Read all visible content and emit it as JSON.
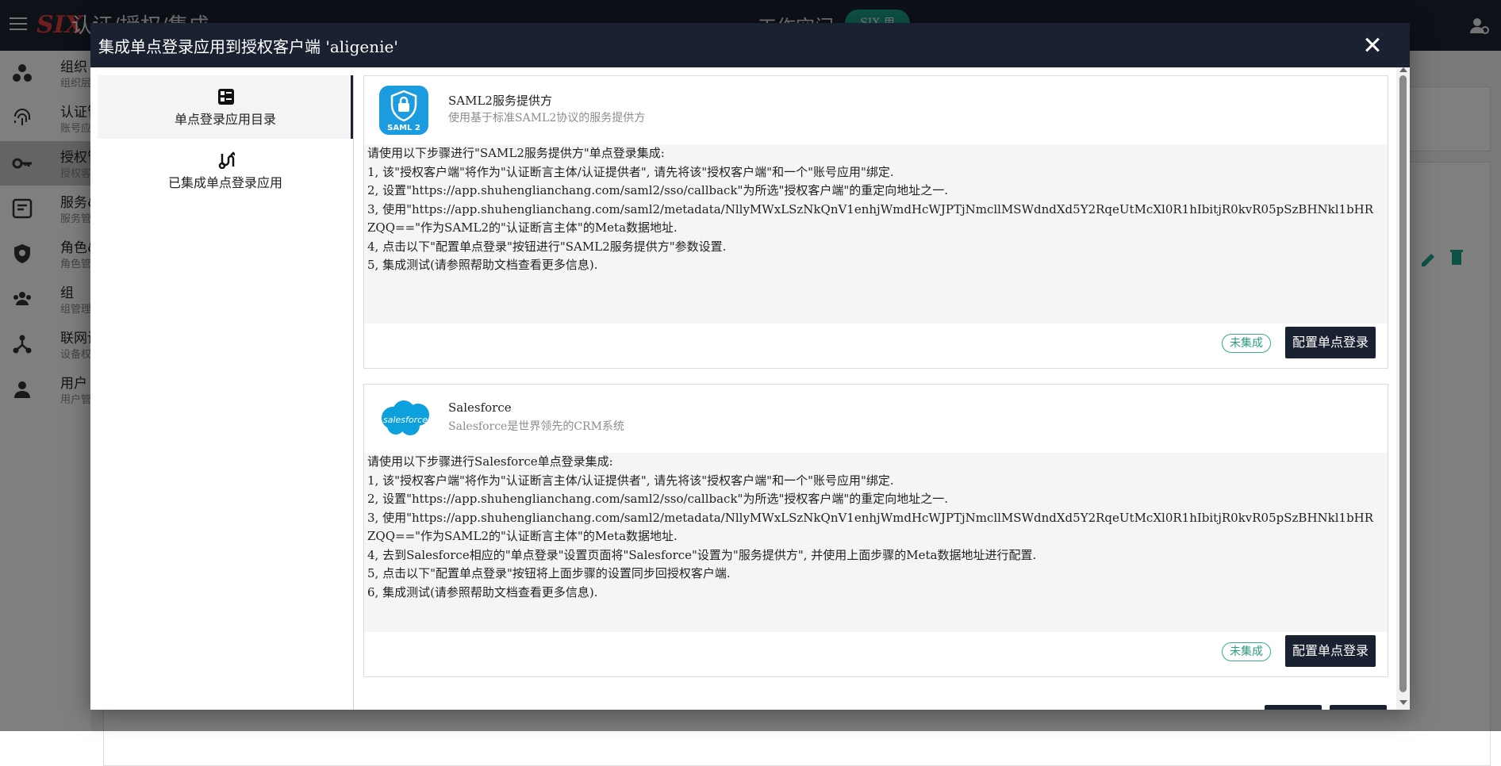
{
  "background": {
    "logo": "SIX",
    "breadcrumb": "认证/授权/集成",
    "workspace_label": "工作空间",
    "workspace_badge": "SIX.用",
    "sidebar": [
      {
        "title": "组织",
        "subtitle": "组织层",
        "icon": "org-dots-icon"
      },
      {
        "title": "认证管",
        "subtitle": "账号应",
        "icon": "fingerprint-icon"
      },
      {
        "title": "授权管",
        "subtitle": "授权客",
        "icon": "key-icon",
        "active": true
      },
      {
        "title": "服务&",
        "subtitle": "服务管",
        "icon": "service-icon"
      },
      {
        "title": "角色&",
        "subtitle": "角色管",
        "icon": "shield-icon"
      },
      {
        "title": "组",
        "subtitle": "组管理",
        "icon": "group-icon"
      },
      {
        "title": "联网设",
        "subtitle": "设备权",
        "icon": "network-icon"
      },
      {
        "title": "用户",
        "subtitle": "用户管",
        "icon": "person-icon"
      }
    ]
  },
  "dialog": {
    "title": "集成单点登录应用到授权客户端 'aligenie'",
    "nav": [
      {
        "label": "单点登录应用目录",
        "icon": "catalog-icon"
      },
      {
        "label": "已集成单点登录应用",
        "icon": "integrated-icon"
      }
    ],
    "cards": [
      {
        "name": "SAML2服务提供方",
        "description": "使用基于标准SAML2协议的服务提供方",
        "logo_text": "SAML 2",
        "steps": [
          "请使用以下步骤进行\"SAML2服务提供方\"单点登录集成:",
          "1, 该\"授权客户端\"将作为\"认证断言主体/认证提供者\", 请先将该\"授权客户端\"和一个\"账号应用\"绑定.",
          "2, 设置\"https://app.shuhenglianchang.com/saml2/sso/callback\"为所选\"授权客户端\"的重定向地址之一.",
          "3, 使用\"https://app.shuhenglianchang.com/saml2/metadata/NllyMWxLSzNkQnV1enhjWmdHcWJPTjNmcllMSWdndXd5Y2RqeUtMcXl0R1hIbitjR0kvR05pSzBHNkl1bHRZQQ==\"作为SAML2的\"认证断言主体\"的Meta数据地址.",
          "4, 点击以下\"配置单点登录\"按钮进行\"SAML2服务提供方\"参数设置.",
          "5, 集成测试(请参照帮助文档查看更多信息)."
        ],
        "status": "未集成",
        "button": "配置单点登录"
      },
      {
        "name": "Salesforce",
        "description": "Salesforce是世界领先的CRM系统",
        "logo_text": "salesforce",
        "steps": [
          "请使用以下步骤进行Salesforce单点登录集成:",
          "1, 该\"授权客户端\"将作为\"认证断言主体/认证提供者\", 请先将该\"授权客户端\"和一个\"账号应用\"绑定.",
          "2, 设置\"https://app.shuhenglianchang.com/saml2/sso/callback\"为所选\"授权客户端\"的重定向地址之一.",
          "3, 使用\"https://app.shuhenglianchang.com/saml2/metadata/NllyMWxLSzNkQnV1enhjWmdHcWJPTjNmcllMSWdndXd5Y2RqeUtMcXl0R1hIbitjR0kvR05pSzBHNkl1bHRZQQ==\"作为SAML2的\"认证断言主体\"的Meta数据地址.",
          "4, 去到Salesforce相应的\"单点登录\"设置页面将\"Salesforce\"设置为\"服务提供方\", 并使用上面步骤的Meta数据地址进行配置.",
          "5, 点击以下\"配置单点登录\"按钮将上面步骤的设置同步回授权客户端.",
          "6, 集成测试(请参照帮助文档查看更多信息)."
        ],
        "status": "未集成",
        "button": "配置单点登录"
      }
    ]
  },
  "colors": {
    "header": "#1a2231",
    "accent_teal": "#2c9b83",
    "saml_blue": "#1b9be0",
    "salesforce_blue": "#0ca0dc"
  }
}
